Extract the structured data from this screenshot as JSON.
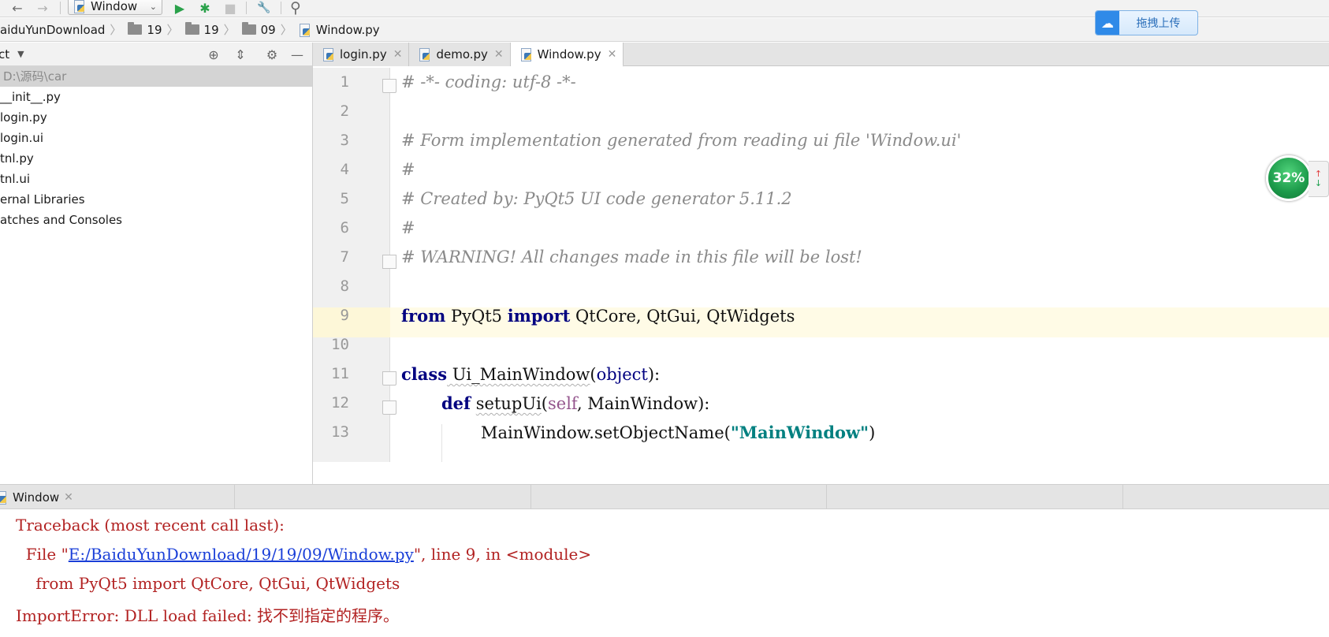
{
  "toolbar": {
    "back_icon": "←",
    "forward_icon": "→",
    "run_config": "Window",
    "run_icon": "▶",
    "debug_icon": "✱",
    "stop_icon": "■",
    "settings_icon": "🔧",
    "search_icon": "⚲"
  },
  "breadcrumb": {
    "items": [
      "aiduYunDownload",
      "19",
      "19",
      "09",
      "Window.py"
    ]
  },
  "upload_widget": {
    "label": "拖拽上传"
  },
  "project": {
    "title": "ct",
    "root_path": "D:\\源码\\car",
    "items": [
      "__init__.py",
      "login.py",
      "login.ui",
      "tnl.py",
      "tnl.ui",
      "ernal Libraries",
      "atches and Consoles"
    ]
  },
  "editor_tabs": [
    {
      "label": "login.py",
      "active": false
    },
    {
      "label": "demo.py",
      "active": false
    },
    {
      "label": "Window.py",
      "active": true
    }
  ],
  "editor": {
    "line_numbers": [
      "1",
      "2",
      "3",
      "4",
      "5",
      "6",
      "7",
      "8",
      "9",
      "10",
      "11",
      "12",
      "13"
    ],
    "line1": "# -*- coding: utf-8 -*-",
    "line3": "# Form implementation generated from reading ui file 'Window.ui'",
    "line4": "#",
    "line5": "# Created by: PyQt5 UI code generator 5.11.2",
    "line6": "#",
    "line7": "# WARNING! All changes made in this file will be lost!",
    "line9": {
      "kw_from": "from",
      "module": " PyQt5 ",
      "kw_import": "import",
      "rest": " QtCore, QtGui, QtWidgets"
    },
    "line11": {
      "kw_class": "class",
      "name": " Ui_MainWindow",
      "open": "(",
      "base": "object",
      "close": "):"
    },
    "line12": {
      "kw_def": "def",
      "sp": " ",
      "name": "setupUi",
      "open": "(",
      "self": "self",
      "rest": ", MainWindow):"
    },
    "line13": {
      "prefix": "MainWindow.setObjectName(",
      "str": "\"MainWindow\"",
      "close": ")"
    }
  },
  "memory_indicator": {
    "value": "32%",
    "up_arrow": "↑",
    "down_arrow": "↓"
  },
  "run_panel": {
    "tab_label": "Window",
    "console": {
      "line1": "Traceback (most recent call last):",
      "line2_prefix": "  File \"",
      "line2_link": "E:/BaiduYunDownload/19/19/09/Window.py",
      "line2_suffix": "\", line 9, in <module>",
      "line3": "    from PyQt5 import QtCore, QtGui, QtWidgets",
      "line4": "ImportError: DLL load failed: 找不到指定的程序。"
    }
  },
  "colors": {
    "keyword": "#000080",
    "comment": "#8a8a8a",
    "string": "#008080",
    "error_text": "#b22222",
    "link": "#1a3fd8",
    "current_line": "#fffbe6"
  }
}
